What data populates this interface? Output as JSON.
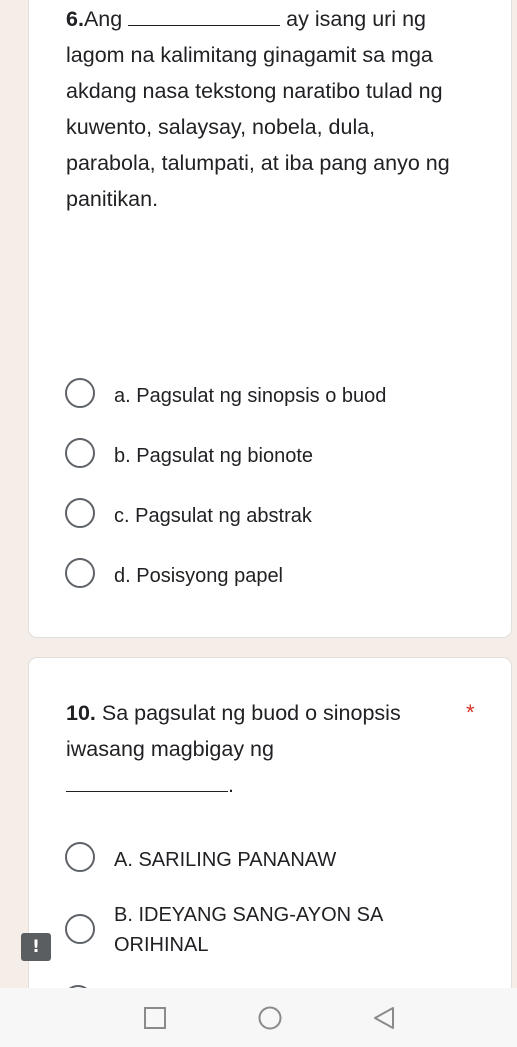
{
  "question_6": {
    "number": "6.",
    "text_start": "Ang",
    "text_rest": " ay isang uri ng lagom na kalimitang ginagamit sa mga akdang nasa tekstong naratibo tulad ng kuwento, salaysay, nobela, dula, parabola, talumpati, at iba pang anyo ng panitikan.",
    "options": [
      {
        "label": "a. Pagsulat ng sinopsis o buod"
      },
      {
        "label": "b. Pagsulat ng bionote"
      },
      {
        "label": "c. Pagsulat ng abstrak"
      },
      {
        "label": "d. Posisyong papel"
      }
    ]
  },
  "question_10": {
    "number": "10.",
    "text": " Sa pagsulat ng buod o sinopsis iwasang magbigay ng",
    "after_blank": ".",
    "required_mark": "*",
    "options": [
      {
        "label": "A. SARILING PANANAW"
      },
      {
        "label": "B. IDEYANG SANG-AYON SA ORIHINAL"
      }
    ]
  },
  "error_badge": "!",
  "colors": {
    "background": "#f5ede8",
    "card": "#ffffff",
    "required": "#d93025",
    "radio_border": "#5f6368"
  },
  "nav_icons": [
    "recent-apps-icon",
    "home-icon",
    "back-icon"
  ]
}
